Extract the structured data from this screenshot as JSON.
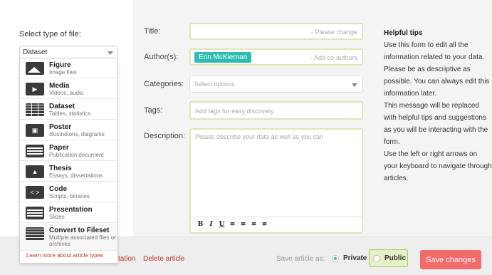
{
  "sidebar": {
    "select_label": "Select type of file:",
    "selected_type": "Dataset",
    "types": [
      {
        "title": "Figure",
        "subtitle": "Image files",
        "icon": "image-icon"
      },
      {
        "title": "Media",
        "subtitle": "Videos, audio",
        "icon": "play-icon"
      },
      {
        "title": "Dataset",
        "subtitle": "Tables, statistics",
        "icon": "table-icon"
      },
      {
        "title": "Poster",
        "subtitle": "Illustrations, diagrams",
        "icon": "poster-icon"
      },
      {
        "title": "Paper",
        "subtitle": "Publication document",
        "icon": "document-icon"
      },
      {
        "title": "Thesis",
        "subtitle": "Essays, dissertations",
        "icon": "graduation-cap-icon"
      },
      {
        "title": "Code",
        "subtitle": "Scripts, binaries",
        "icon": "code-icon"
      },
      {
        "title": "Presentation",
        "subtitle": "Slides",
        "icon": "presentation-icon"
      },
      {
        "title": "Convert to Fileset",
        "subtitle": "Multiple associated files or archives",
        "icon": "fileset-icon"
      }
    ],
    "learn_more": "Learn more about article types"
  },
  "form": {
    "title_label": "Title:",
    "title_placeholder": "- Please change",
    "authors_label": "Author(s):",
    "author_chip": "Erin McKiernan",
    "authors_placeholder": "- Add co-authors",
    "categories_label": "Categories:",
    "categories_placeholder": "Select options",
    "tags_label": "Tags:",
    "tags_placeholder": "Add tags for easy discovery",
    "description_label": "Description:",
    "description_placeholder": "Please describe your data as well as you can",
    "toolbar": {
      "bold": "B",
      "italic": "I",
      "underline": "U"
    }
  },
  "tips": {
    "heading": "Helpful tips",
    "p1": "Use this form to edit all the information related to your data. Please be as descriptive as possible. You can always edit this information later.",
    "p2": "This message will be replaced with helpful tips and suggestions as you will be interacting with the form.",
    "p3": "Use the left or right arrows on your keyboard to navigate through articles."
  },
  "bottom_bar": {
    "partial_link": "tation",
    "delete_link": "Delete article",
    "save_as_label": "Save article as:",
    "private_label": "Private",
    "public_label": "Public",
    "save_button": "Save changes",
    "selected_visibility": "Private"
  },
  "colors": {
    "accent_teal": "#2fbcb0",
    "save_red": "#f26b6b",
    "field_border_green": "#dbe7b9",
    "link_red": "#c0392b"
  }
}
